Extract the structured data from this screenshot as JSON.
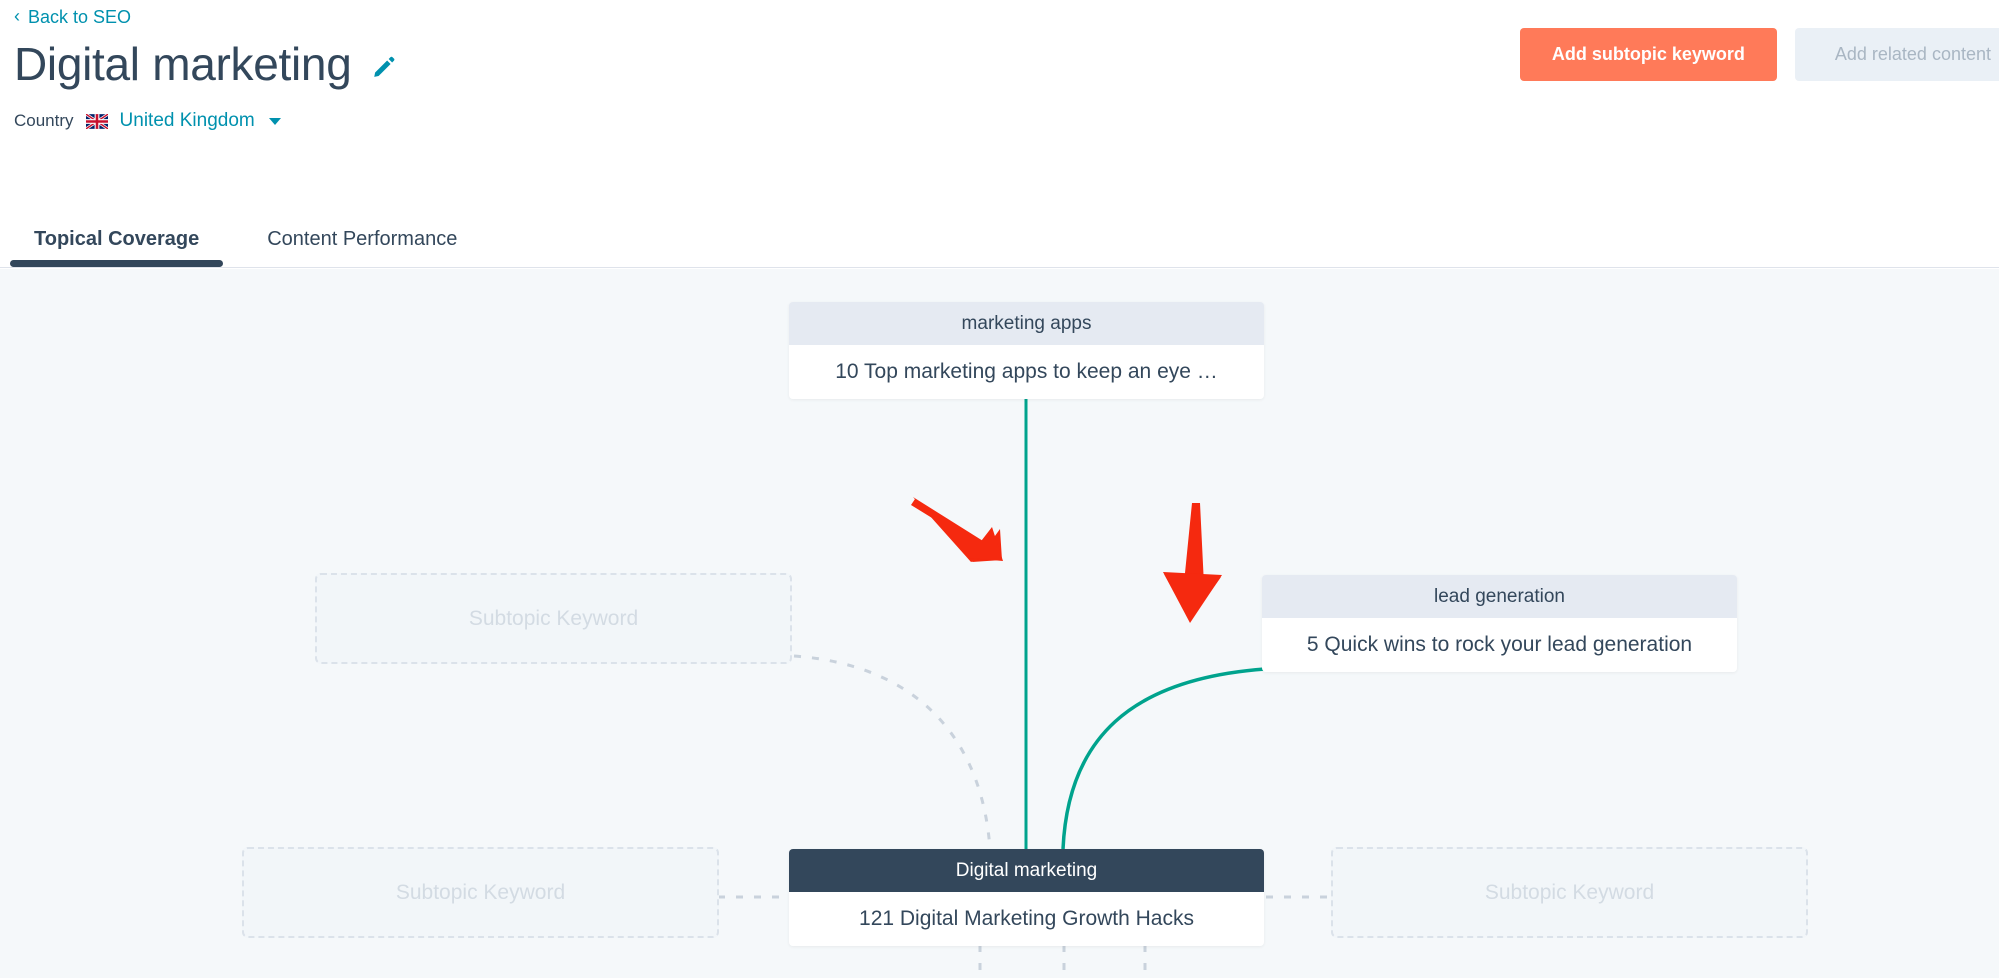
{
  "header": {
    "back_link": "Back to SEO",
    "back_icon": "chevron-left-icon",
    "title": "Digital marketing",
    "edit_icon": "pencil-edit-icon",
    "primary_button": "Add subtopic keyword",
    "secondary_button": "Add related content",
    "country_label": "Country",
    "country_flag_icon": "united-kingdom-flag-icon",
    "country_value": "United Kingdom",
    "country_caret_icon": "chevron-down-icon"
  },
  "tabs": [
    {
      "label": "Topical Coverage",
      "active": true
    },
    {
      "label": "Content Performance",
      "active": false
    }
  ],
  "cluster": {
    "core": {
      "keyword": "Digital marketing",
      "content": "121 Digital Marketing Growth Hacks"
    },
    "subtopics": [
      {
        "keyword": "marketing apps",
        "content": "10 Top marketing apps to keep an eye …"
      },
      {
        "keyword": "lead generation",
        "content": "5 Quick wins to rock your lead generation"
      }
    ],
    "placeholders": [
      {
        "label": "Subtopic Keyword"
      },
      {
        "label": "Subtopic Keyword"
      },
      {
        "label": "Subtopic Keyword"
      }
    ]
  },
  "colors": {
    "accent_orange": "#ff7a59",
    "link_teal": "#0091ae",
    "core_navy": "#33475b",
    "connector_green": "#00a38d",
    "connector_dashed": "#c9d2dc",
    "canvas_bg": "#f5f8fa",
    "annotation_red": "#f5290f"
  },
  "annotations": [
    {
      "name": "red-arrow-diagonal",
      "direction": "down-right"
    },
    {
      "name": "red-arrow-vertical",
      "direction": "down"
    }
  ]
}
